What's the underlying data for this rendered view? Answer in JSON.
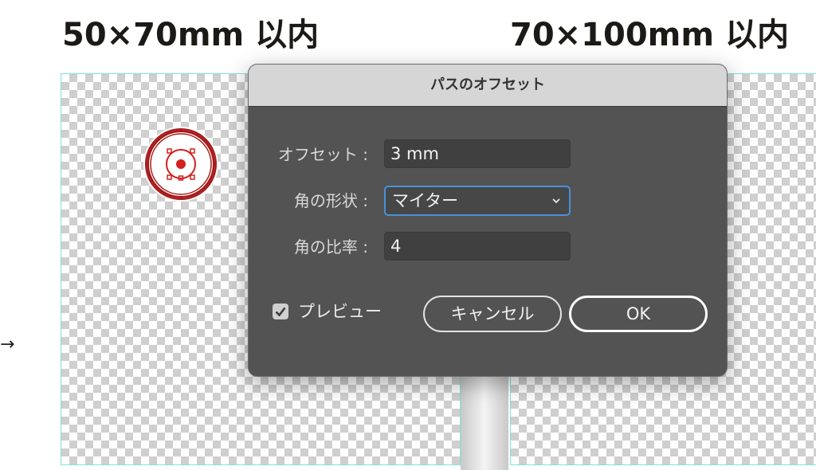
{
  "headings": {
    "left": "50×70mm 以内",
    "right": "70×100mm 以内"
  },
  "canvas": {
    "arrow_glyph": "→"
  },
  "dialog": {
    "title": "パスのオフセット",
    "offset": {
      "label": "オフセット :",
      "value": "3 mm"
    },
    "joins": {
      "label": "角の形状 :",
      "selected": "マイター"
    },
    "miter_limit": {
      "label": "角の比率 :",
      "value": "4"
    },
    "preview": {
      "label": "プレビュー",
      "checked": true
    },
    "cancel_label": "キャンセル",
    "ok_label": "OK"
  },
  "colors": {
    "dialog_bg": "#535353",
    "titlebar_bg": "#d6d6d6",
    "focus_ring": "#4a90d9",
    "guide": "#7fe1e1",
    "stamp_red": "#d32020"
  },
  "icons": [
    "chevron-down-icon",
    "checkmark-icon",
    "target-stamp-icon",
    "arrow-right-icon"
  ]
}
